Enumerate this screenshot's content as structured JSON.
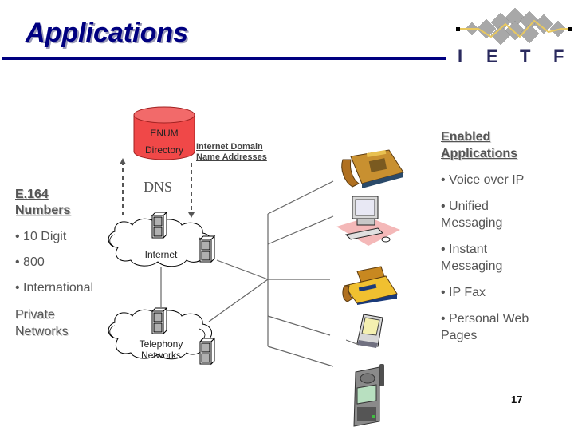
{
  "slide": {
    "title": "Applications",
    "page_number": "17",
    "logo": {
      "letters": [
        "I",
        "E",
        "T",
        "F"
      ],
      "icon": "ietf-diamond-lattice-icon"
    },
    "colors": {
      "title": "#000080",
      "rule": "#000080",
      "enum_cylinder": "#f04848",
      "text_gray": "#555555"
    }
  },
  "diagram": {
    "enum_directory": {
      "line1": "ENUM",
      "line2": "Directory"
    },
    "dns_label": "DNS",
    "internet_domain": {
      "line1": "Internet Domain",
      "line2": "Name Addresses"
    },
    "clouds": [
      {
        "label_lines": [
          "Internet"
        ]
      },
      {
        "label_lines": [
          "Telephony",
          "Networks"
        ]
      }
    ],
    "devices": [
      {
        "name": "desk-phone",
        "icon": "telephone-icon"
      },
      {
        "name": "computer",
        "icon": "computer-icon"
      },
      {
        "name": "fax",
        "icon": "fax-machine-icon"
      },
      {
        "name": "pda",
        "icon": "pda-icon"
      },
      {
        "name": "mobile-phone",
        "icon": "mobile-phone-icon"
      }
    ]
  },
  "left_panel": {
    "heading_line1": "E.164",
    "heading_line2": "Numbers",
    "items": [
      "• 10 Digit",
      "• 800",
      "• International"
    ],
    "footer_line1": "Private",
    "footer_line2": "Networks"
  },
  "right_panel": {
    "heading_line1": "Enabled",
    "heading_line2": "Applications",
    "items": [
      {
        "line1": "• Voice over IP"
      },
      {
        "line1": "• Unified",
        "line2": "Messaging"
      },
      {
        "line1": "• Instant",
        "line2": "Messaging"
      },
      {
        "line1": "• IP Fax"
      },
      {
        "line1": "• Personal Web",
        "line2": "Pages"
      }
    ]
  }
}
